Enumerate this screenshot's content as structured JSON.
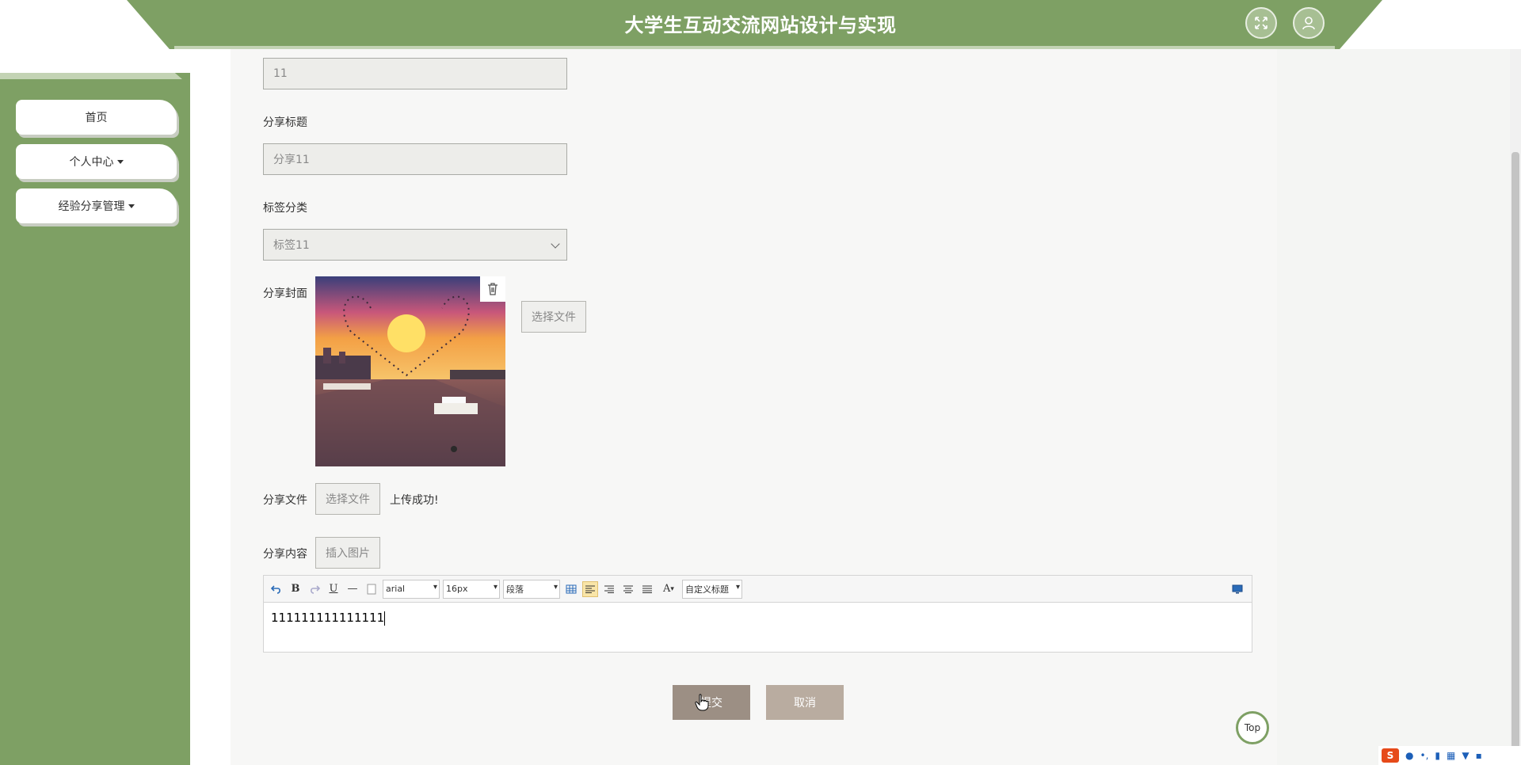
{
  "header": {
    "title": "大学生互动交流网站设计与实现",
    "colors": {
      "primary": "#7ea064",
      "accent": "#c3d3b4"
    }
  },
  "sidebar": {
    "items": [
      {
        "label": "首页"
      },
      {
        "label": "个人中心"
      },
      {
        "label": "经验分享管理"
      }
    ]
  },
  "form": {
    "first_field_value": "11",
    "title_label": "分享标题",
    "title_value": "分享11",
    "tag_label": "标签分类",
    "tag_value": "标签11",
    "cover_label": "分享封面",
    "cover_button": "选择文件",
    "file_label": "分享文件",
    "file_button": "选择文件",
    "file_status": "上传成功!",
    "content_label": "分享内容",
    "insert_image_button": "插入图片"
  },
  "editor": {
    "font_family": "arial",
    "font_size": "16px",
    "paragraph": "段落",
    "custom_title": "自定义标题",
    "content": "111111111111111"
  },
  "actions": {
    "submit": "提交",
    "cancel": "取消",
    "submit_color": "#9c8f84",
    "cancel_color": "#b9aca0"
  },
  "top_button": "Top"
}
